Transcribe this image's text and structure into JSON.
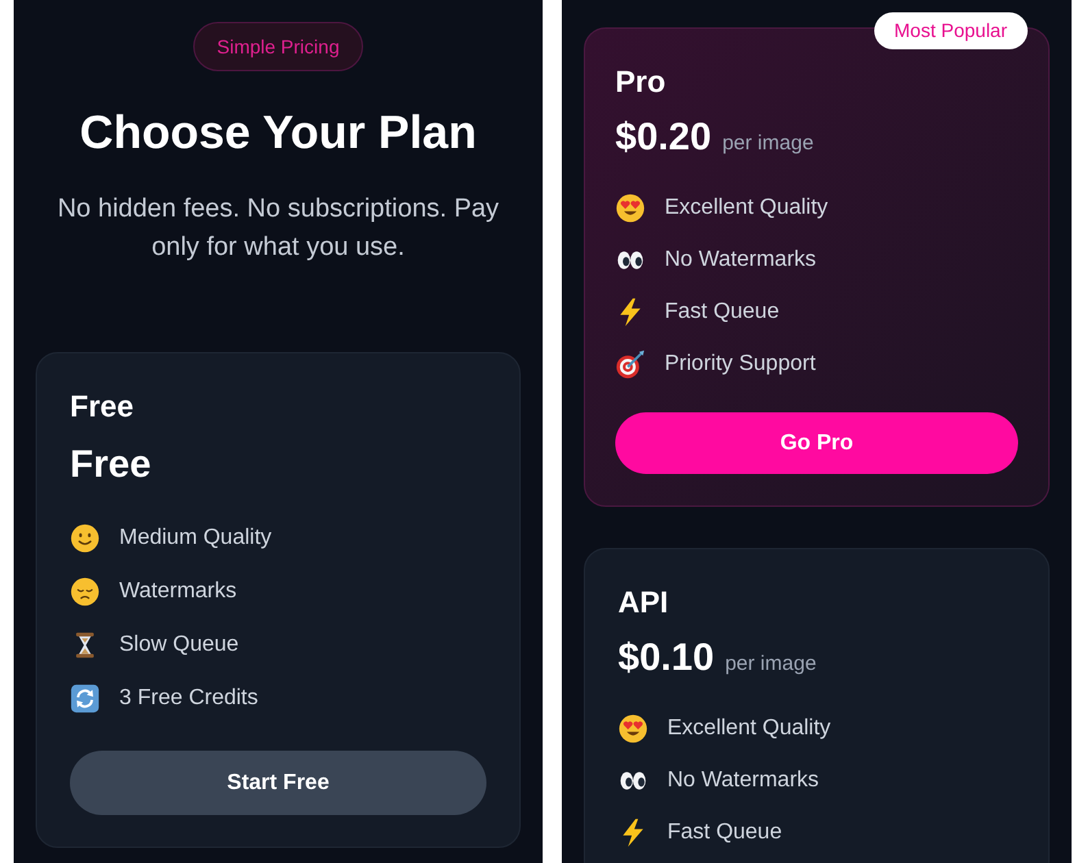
{
  "screens": [
    {
      "badge": {
        "label": "Simple Pricing"
      },
      "heading": "Choose Your Plan",
      "subtitle": "No hidden fees. No subscriptions. Pay only for what you use.",
      "plans": [
        {
          "name": "Free",
          "price": "Free",
          "featured": false,
          "features": [
            {
              "kind": "smile",
              "text": "Medium Quality"
            },
            {
              "kind": "sad",
              "text": "Watermarks"
            },
            {
              "kind": "hourglass",
              "text": "Slow Queue"
            },
            {
              "kind": "repeat",
              "text": "3 Free Credits"
            }
          ],
          "button": "Start Free"
        }
      ]
    },
    {
      "plans": [
        {
          "name": "Pro",
          "price": "$0.20",
          "unit": "per image",
          "featured": true,
          "ribbon": "Most Popular",
          "features": [
            {
              "kind": "hearteyes",
              "text": "Excellent Quality"
            },
            {
              "kind": "eyes",
              "text": "No Watermarks"
            },
            {
              "kind": "bolt",
              "text": "Fast Queue"
            },
            {
              "kind": "target",
              "text": "Priority Support"
            }
          ],
          "button": "Go Pro"
        },
        {
          "name": "API",
          "price": "$0.10",
          "unit": "per image",
          "featured": false,
          "features": [
            {
              "kind": "hearteyes",
              "text": "Excellent Quality"
            },
            {
              "kind": "eyes",
              "text": "No Watermarks"
            },
            {
              "kind": "bolt",
              "text": "Fast Queue"
            }
          ]
        }
      ]
    }
  ]
}
